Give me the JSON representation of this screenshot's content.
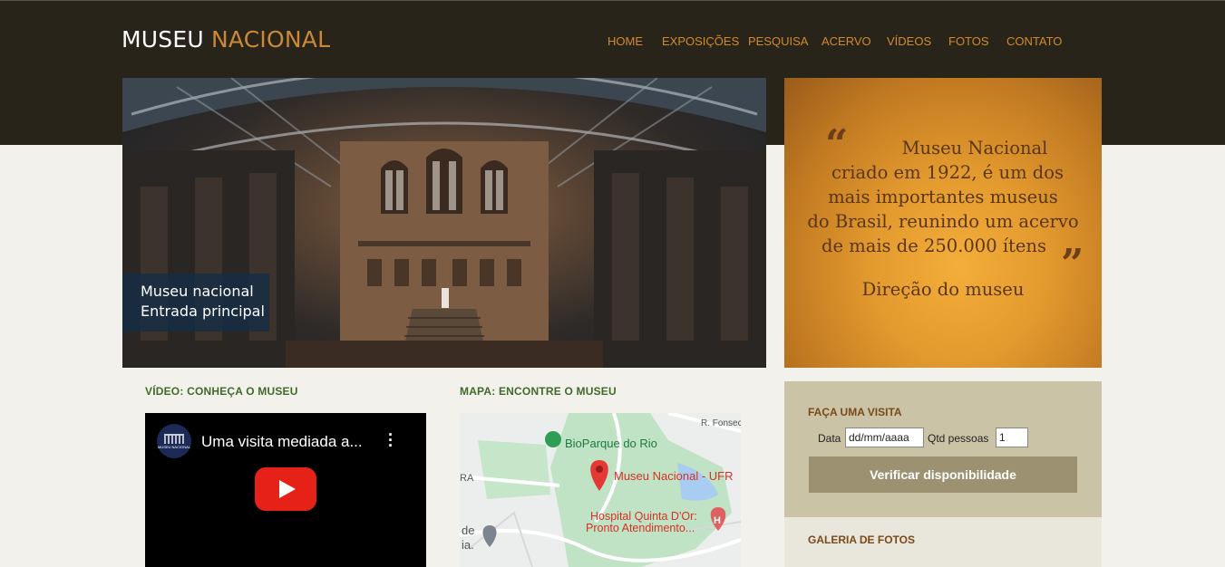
{
  "header": {
    "logo_part1": "MUSEU",
    "logo_part2": "NACIONAL",
    "nav": [
      "HOME",
      "EXPOSIÇÕES",
      "PESQUISA",
      "ACERVO",
      "VÍDEOS",
      "FOTOS",
      "CONTATO"
    ]
  },
  "hero": {
    "caption_line1": "Museu nacional",
    "caption_line2": "Entrada principal"
  },
  "quote": {
    "open_mark": "“",
    "close_mark": "”",
    "lines": [
      "Museu Nacional",
      "criado em 1922, é um dos",
      "mais importantes museus",
      "do Brasil, reunindo um acervo",
      "de mais de 250.000 ítens"
    ],
    "author": "Direção do museu"
  },
  "video": {
    "section_title": "VÍDEO: CONHEÇA O MUSEU",
    "title": "Uma visita mediada a...",
    "channel_badge": "MUSEU NACIONAL"
  },
  "map": {
    "section_title": "MAPA: ENCONTRE O MUSEU",
    "labels": {
      "street": "R. Fonsec",
      "park": "BioParque do Rio",
      "museum": "Museu Nacional - UFR",
      "hospital_line1": "Hospital Quinta D'Or:",
      "hospital_line2": "Pronto Atendimento...",
      "edge_top": "RA",
      "edge_bottom1": "de",
      "edge_bottom2": "ia."
    }
  },
  "visit": {
    "title": "FAÇA UMA VISITA",
    "date_label": "Data",
    "date_placeholder": "dd/mm/aaaa",
    "people_label": "Qtd pessoas",
    "people_value": "1",
    "button_label": "Verificar disponibilidade"
  },
  "gallery": {
    "title": "GALERIA DE FOTOS"
  },
  "colors": {
    "header_bg": "#29241a",
    "nav_text": "#d08a2e",
    "logo_accent": "#c9893a",
    "section_title": "#3f6a2a",
    "button_bg": "#9c9272"
  }
}
